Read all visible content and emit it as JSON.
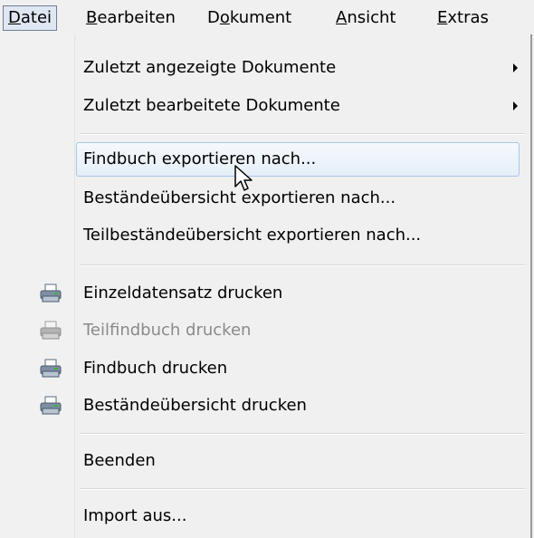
{
  "menubar": {
    "items": [
      {
        "pre": "",
        "acc": "D",
        "post": "atei"
      },
      {
        "pre": "",
        "acc": "B",
        "post": "earbeiten"
      },
      {
        "pre": "D",
        "acc": "o",
        "post": "kument"
      },
      {
        "pre": "",
        "acc": "A",
        "post": "nsicht"
      },
      {
        "pre": "",
        "acc": "E",
        "post": "xtras"
      }
    ]
  },
  "menu": {
    "recent_viewed": "Zuletzt angezeigte Dokumente",
    "recent_edited": "Zuletzt bearbeitete Dokumente",
    "export_findbuch": "Findbuch exportieren nach...",
    "export_bestand": "Beständeübersicht exportieren nach...",
    "export_teilbestand": "Teilbeständeübersicht exportieren nach...",
    "print_einzel": "Einzeldatensatz drucken",
    "print_teilfindbuch": "Teilfindbuch drucken",
    "print_findbuch": "Findbuch drucken",
    "print_bestand": "Beständeübersicht drucken",
    "quit": "Beenden",
    "import": "Import aus..."
  },
  "icons": {
    "printer_enabled": "printer-icon",
    "printer_disabled": "printer-disabled-icon"
  },
  "colors": {
    "highlight_border": "#a8c8ea",
    "open_menu_bg": "#dfe7f3",
    "disabled_text": "#8a8a8a"
  }
}
